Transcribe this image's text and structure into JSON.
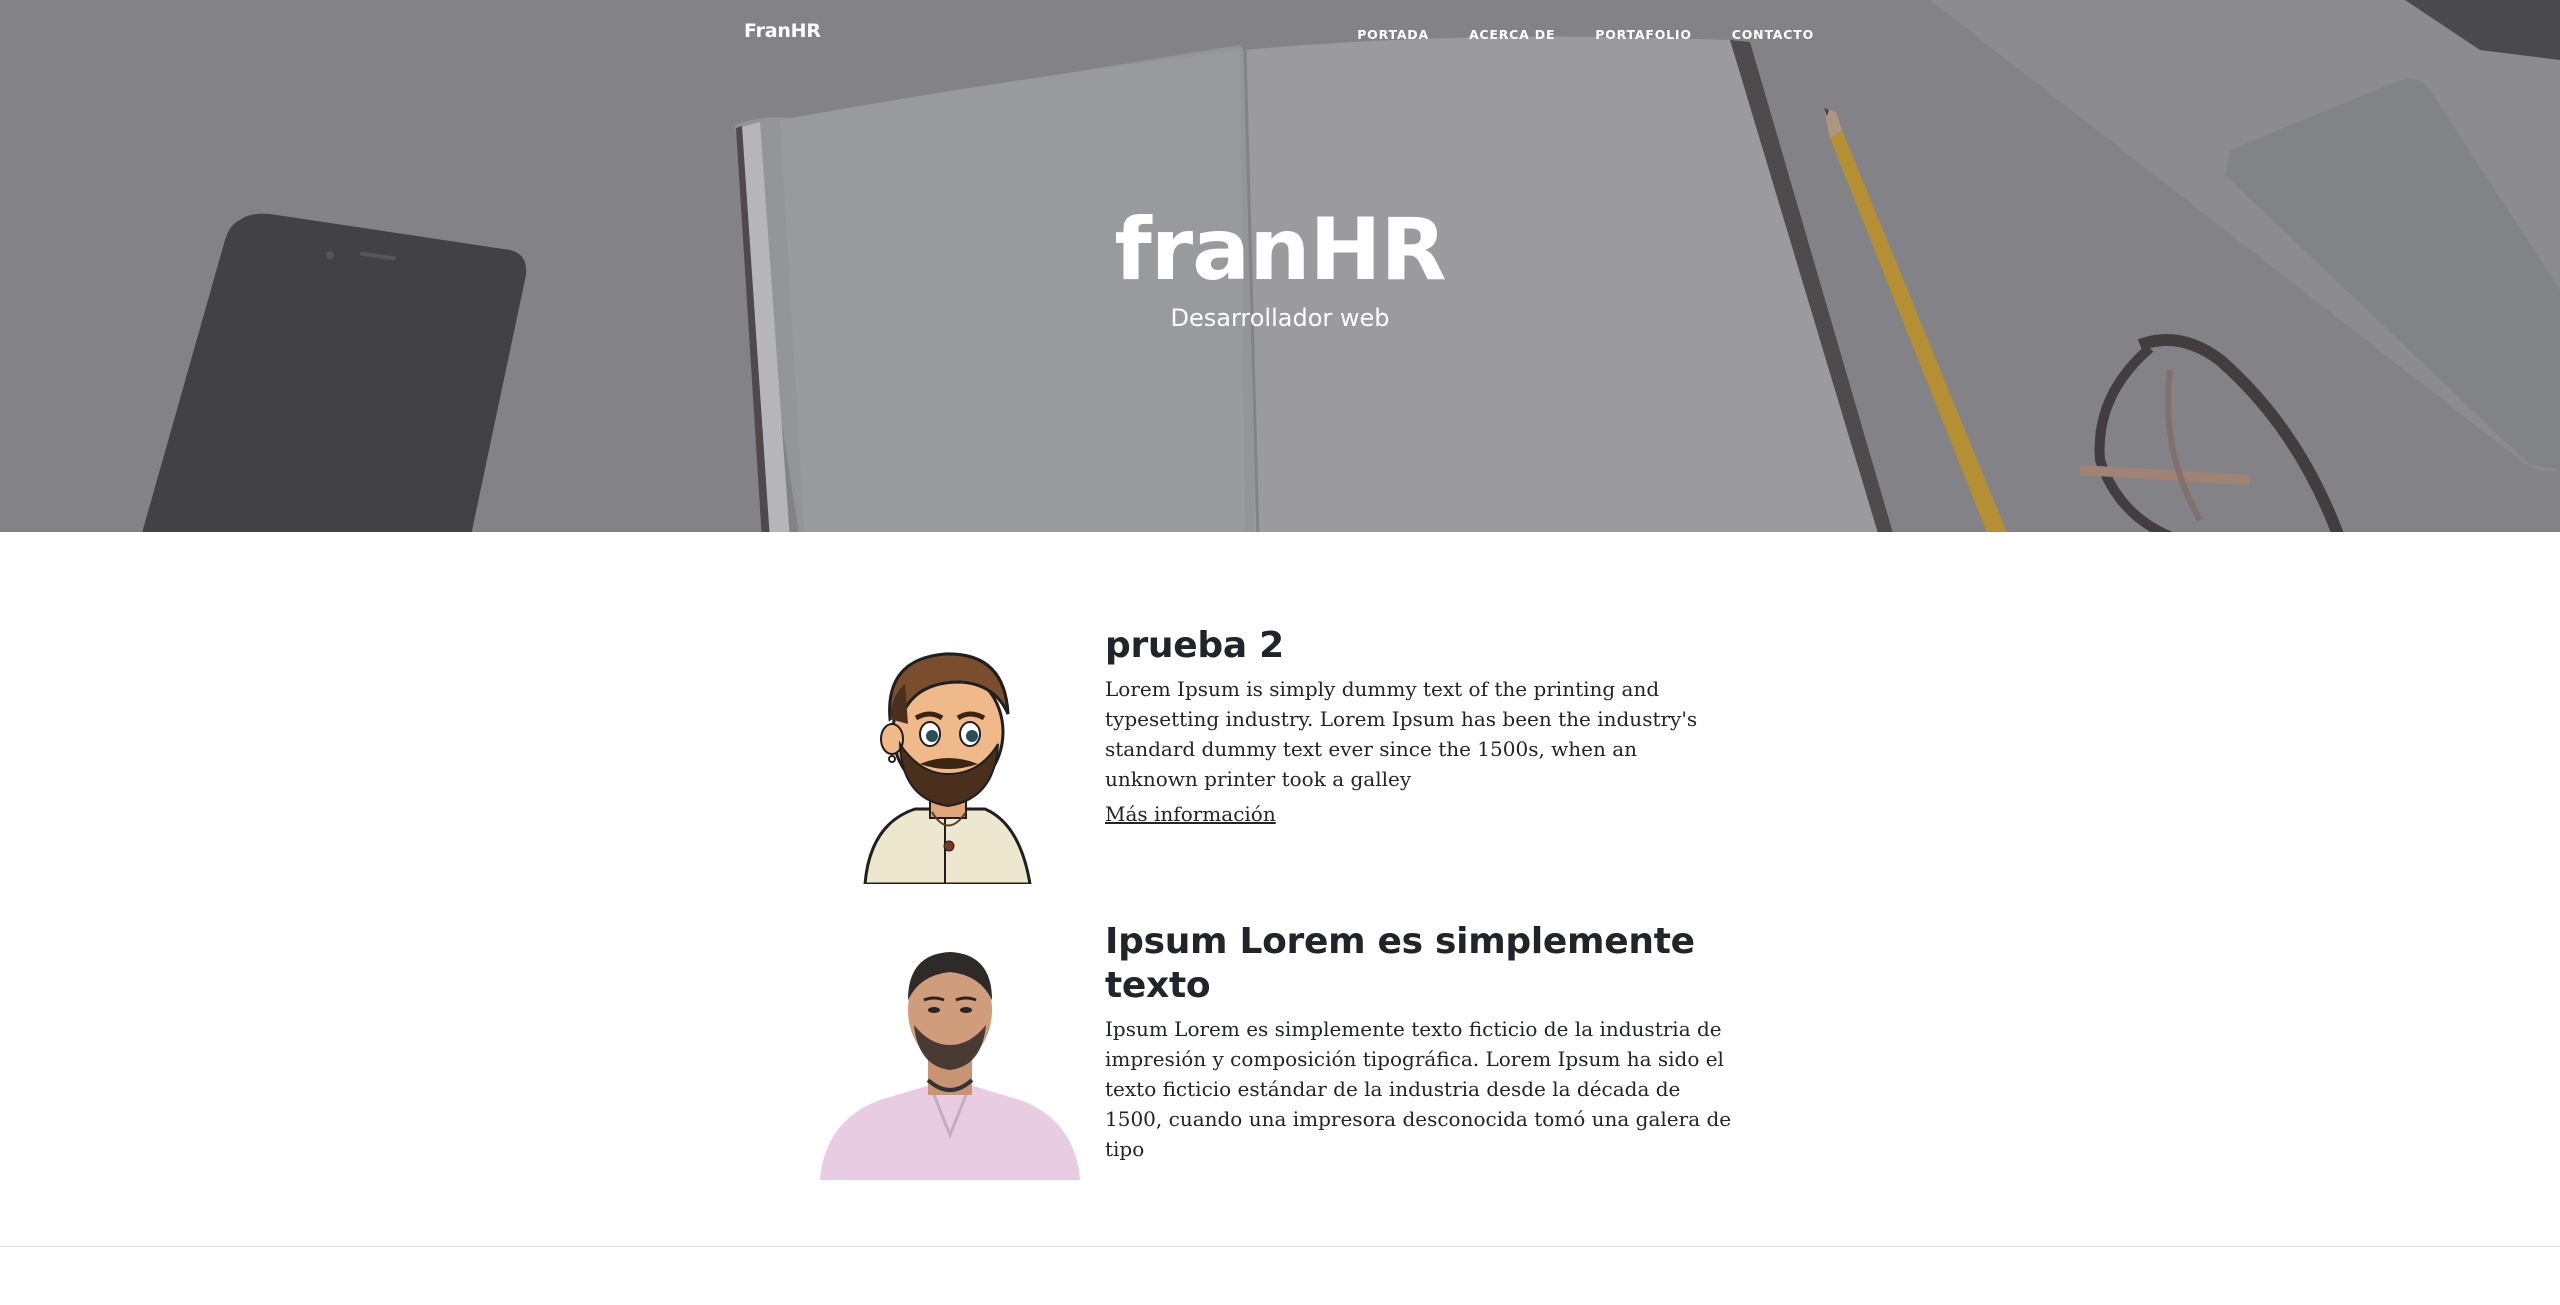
{
  "nav": {
    "brand": "FranHR",
    "links": [
      {
        "label": "PORTADA"
      },
      {
        "label": "ACERCA DE"
      },
      {
        "label": "PORTAFOLIO"
      },
      {
        "label": "CONTACTO"
      }
    ]
  },
  "hero": {
    "title": "franHR",
    "subtitle": "Desarrollador web"
  },
  "posts": [
    {
      "title": "prueba 2",
      "text": "Lorem Ipsum is simply dummy text of the printing and typesetting industry. Lorem Ipsum has been the industry's standard dummy text ever since the 1500s, when an unknown printer took a galley",
      "link": "Más información"
    },
    {
      "title": "Ipsum Lorem es simplemente texto",
      "text": "Ipsum Lorem es simplemente texto ficticio de la industria de impresión y composición tipográfica. Lorem Ipsum ha sido el texto ficticio estándar de la industria desde la década de 1500, cuando una impresora desconocida tomó una galera de tipo"
    }
  ],
  "colors": {
    "text": "#212529",
    "hero_overlay": "#7b7c80",
    "nav_text": "#ffffff"
  }
}
